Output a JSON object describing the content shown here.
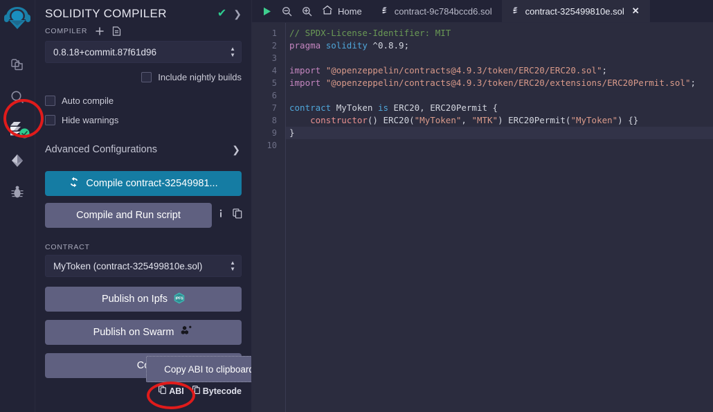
{
  "app": {
    "name": "Remix IDE",
    "accent": "#157ca3",
    "highlight_color": "#e01b1b",
    "success_color": "#2ecc8f"
  },
  "iconbar": {
    "items": [
      {
        "name": "remix-logo-icon",
        "label": "Remix"
      },
      {
        "name": "file-explorer-icon",
        "label": "File explorer"
      },
      {
        "name": "search-icon",
        "label": "Search in files"
      },
      {
        "name": "solidity-compiler-icon",
        "label": "Solidity compiler",
        "active": true,
        "badge": "check"
      },
      {
        "name": "deploy-run-icon",
        "label": "Deploy & run transactions"
      },
      {
        "name": "debugger-icon",
        "label": "Debugger"
      }
    ]
  },
  "panel": {
    "title": "SOLIDITY COMPILER",
    "header_check": "✔",
    "header_caret": "❯",
    "compiler_label": "COMPILER",
    "add_icon": "plus-icon",
    "file_icon": "document-icon",
    "version_value": "0.8.18+commit.87f61d96",
    "nightly_label": "Include nightly builds",
    "autocompile_label": "Auto compile",
    "hidewarnings_label": "Hide warnings",
    "advanced_label": "Advanced Configurations",
    "advanced_caret": "❯",
    "compile_button": "Compile contract-32549981...",
    "compile_icon": "refresh-icon",
    "compile_run_button": "Compile and Run script",
    "info_icon": "info-icon",
    "copy-icon": "copy-icon",
    "contract_label": "CONTRACT",
    "contract_value": "MyToken (contract-325499810e.sol)",
    "publish_ipfs": "Publish on Ipfs",
    "publish_ipfs_icon": "ipfs-logo-icon",
    "publish_swarm": "Publish on Swarm",
    "publish_swarm_icon": "swarm-logo-icon",
    "compilation_details": "Co",
    "tooltip_text": "Copy ABI to clipboard",
    "copy_abi": "ABI",
    "copy_bytecode": "Bytecode"
  },
  "editor": {
    "toolbar": {
      "run_icon": "play-icon",
      "zoom_out_icon": "zoom-out-icon",
      "zoom_in_icon": "zoom-in-icon",
      "home_icon": "home-icon",
      "home_label": "Home"
    },
    "tabs": [
      {
        "label": "contract-9c784bccd6.sol",
        "icon": "solidity-icon",
        "active": false,
        "closable": false
      },
      {
        "label": "contract-325499810e.sol",
        "icon": "solidity-icon",
        "active": true,
        "closable": true,
        "close_glyph": "✕"
      }
    ],
    "line_numbers": [
      "1",
      "2",
      "3",
      "4",
      "5",
      "6",
      "7",
      "8",
      "9",
      "10"
    ],
    "current_line": 9,
    "code_lines": [
      {
        "n": 1,
        "tokens": [
          {
            "t": "// SPDX-License-Identifier: MIT",
            "c": "c-com"
          }
        ]
      },
      {
        "n": 2,
        "tokens": [
          {
            "t": "pragma",
            "c": "c-kw2"
          },
          {
            "t": " ",
            "c": "c-plain"
          },
          {
            "t": "solidity",
            "c": "c-kw"
          },
          {
            "t": " ^0.8.9;",
            "c": "c-plain"
          }
        ]
      },
      {
        "n": 3,
        "tokens": []
      },
      {
        "n": 4,
        "tokens": [
          {
            "t": "import",
            "c": "c-kw2"
          },
          {
            "t": " ",
            "c": "c-plain"
          },
          {
            "t": "\"@openzeppelin/contracts@4.9.3/token/ERC20/ERC20.sol\"",
            "c": "c-str"
          },
          {
            "t": ";",
            "c": "c-plain"
          }
        ]
      },
      {
        "n": 5,
        "tokens": [
          {
            "t": "import",
            "c": "c-kw2"
          },
          {
            "t": " ",
            "c": "c-plain"
          },
          {
            "t": "\"@openzeppelin/contracts@4.9.3/token/ERC20/extensions/ERC20Permit.sol\"",
            "c": "c-str"
          },
          {
            "t": ";",
            "c": "c-plain"
          }
        ]
      },
      {
        "n": 6,
        "tokens": []
      },
      {
        "n": 7,
        "tokens": [
          {
            "t": "contract",
            "c": "c-kw"
          },
          {
            "t": " MyToken ",
            "c": "c-plain"
          },
          {
            "t": "is",
            "c": "c-kw"
          },
          {
            "t": " ERC20, ERC20Permit {",
            "c": "c-plain"
          }
        ]
      },
      {
        "n": 8,
        "tokens": [
          {
            "t": "    ",
            "c": "c-plain"
          },
          {
            "t": "constructor",
            "c": "c-fn"
          },
          {
            "t": "() ERC20(",
            "c": "c-plain"
          },
          {
            "t": "\"MyToken\"",
            "c": "c-str"
          },
          {
            "t": ", ",
            "c": "c-plain"
          },
          {
            "t": "\"MTK\"",
            "c": "c-str"
          },
          {
            "t": ") ERC20Permit(",
            "c": "c-plain"
          },
          {
            "t": "\"MyToken\"",
            "c": "c-str"
          },
          {
            "t": ") {}",
            "c": "c-plain"
          }
        ]
      },
      {
        "n": 9,
        "tokens": [
          {
            "t": "}",
            "c": "c-plain"
          }
        ]
      },
      {
        "n": 10,
        "tokens": []
      }
    ]
  }
}
